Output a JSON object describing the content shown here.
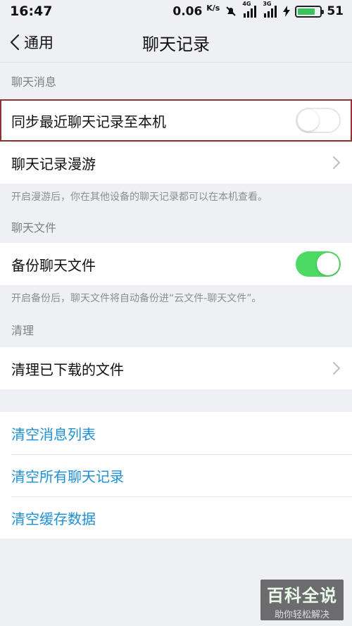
{
  "status": {
    "time": "16:47",
    "speed": "0.06",
    "speed_unit": "K/s",
    "net1": "4G",
    "net2": "3G",
    "battery": "51"
  },
  "nav": {
    "back_label": "通用",
    "title": "聊天记录"
  },
  "sections": {
    "messages": {
      "header": "聊天消息",
      "sync_label": "同步最近聊天记录至本机",
      "sync_on": false,
      "roam_label": "聊天记录漫游",
      "hint": "开启漫游后，你在其他设备的聊天记录都可以在本机查看。"
    },
    "files": {
      "header": "聊天文件",
      "backup_label": "备份聊天文件",
      "backup_on": true,
      "hint": "开启备份后，聊天文件将自动备份进“云文件-聊天文件”。"
    },
    "cleanup": {
      "header": "清理",
      "clean_downloads_label": "清理已下载的文件"
    },
    "clear": {
      "clear_msg_list": "清空消息列表",
      "clear_all_history": "清空所有聊天记录",
      "clear_cache": "清空缓存数据"
    }
  },
  "watermark": {
    "main": "百科全说",
    "sub": "助你轻松解决"
  },
  "colors": {
    "link": "#1d8fd6",
    "toggle_on": "#4cd964",
    "highlight": "#8f3234"
  }
}
